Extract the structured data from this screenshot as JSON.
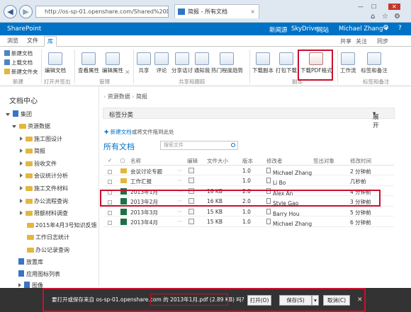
{
  "browser": {
    "address": "http://os-sp-01.openshare.com/Shared%20D",
    "address_host": "os-sp-01.openshare.com",
    "tab_title": "简报 - 所有文档",
    "tab_close": "×",
    "window_min": "—",
    "window_max": "☐",
    "window_close": "✕",
    "home": "⌂",
    "favorites": "☆",
    "settings": "⚙"
  },
  "topbar": {
    "brand": "SharePoint",
    "links": [
      "新闻源",
      "SkyDrive",
      "网站"
    ],
    "user": "Michael Zhang ▾",
    "gear": "⚙",
    "help": "?"
  },
  "ribbon_tabs": [
    "浏览",
    "文件",
    "库"
  ],
  "ribbon_tools": {
    "share": "共享",
    "follow": "关注",
    "sync": "同步"
  },
  "ribbon": {
    "new_doc": "新建文档",
    "upload": "上载文档",
    "new_folder": "新建文件夹",
    "edit_doc": "编辑文档",
    "view_props": "查看属性",
    "edit_props": "编辑属性",
    "share": "共享",
    "comment": "评论",
    "share_to": "分享话讨",
    "alert": "通知我",
    "popular": "热门程度趋势",
    "download": "下载副本",
    "pack_download": "打包下载",
    "pdf": "下载PDF格式",
    "workflow": "工作流",
    "tags": "标签和备注",
    "groups": [
      "新建",
      "打开并签出",
      "管理",
      "共享和跟踪",
      "副本",
      "标签和备注"
    ]
  },
  "nav": {
    "title": "文档中心",
    "items": [
      "集团",
      "资源数据",
      "施工图设计",
      "简报",
      "验收文件",
      "会议统计分析",
      "施工文件材料",
      "办公流程查询",
      "限额材料调查",
      "2015年4月3号知识反馈",
      "工作日志统计",
      "办公记录查询",
      "放置库",
      "应用图标列表",
      "图像"
    ]
  },
  "breadcrumb": [
    "资源数据",
    "简报"
  ],
  "classify": {
    "label": "标签分类",
    "expand": "展开"
  },
  "newdoc": {
    "link": "新建文档",
    "rest": "或将文件拖到此处"
  },
  "view": {
    "title": "所有文档",
    "search_placeholder": "搜索文件"
  },
  "columns": [
    "名称",
    "编辑",
    "文件大小",
    "版本",
    "修改者",
    "签出对象",
    "修改时间"
  ],
  "rows": [
    {
      "type": "folder",
      "name": "会议讨论专题",
      "size": "",
      "version": "1.0",
      "modifier": "Michael Zhang",
      "checkout": "",
      "time": "2 分钟前"
    },
    {
      "type": "folder",
      "name": "工作汇报",
      "size": "",
      "version": "1.0",
      "modifier": "Li Bo",
      "checkout": "",
      "time": "几秒前"
    },
    {
      "type": "xls",
      "name": "2013年1月",
      "size": "18 KB",
      "version": "2.0",
      "modifier": "Alex An",
      "checkout": "",
      "time": "4 分钟前"
    },
    {
      "type": "xls",
      "name": "2013年2月",
      "size": "16 KB",
      "version": "2.0",
      "modifier": "Style Gao",
      "checkout": "",
      "time": "3 分钟前"
    },
    {
      "type": "xls",
      "name": "2013年3月",
      "size": "15 KB",
      "version": "1.0",
      "modifier": "Barry Hou",
      "checkout": "",
      "time": "5 分钟前"
    },
    {
      "type": "xls",
      "name": "2013年4月",
      "size": "15 KB",
      "version": "1.0",
      "modifier": "Michael Zhang",
      "checkout": "",
      "time": "6 分钟前"
    }
  ],
  "download_bar": {
    "prefix": "要打开或保存来自",
    "host": "os-sp-01.openshare.com",
    "mid": "的",
    "filename": "2013年1月.pdf",
    "size": "(2.89 KB)",
    "suffix": "吗?",
    "open": "打开(O)",
    "save": "保存(S)",
    "save_arrow": "▾",
    "cancel": "取消(C)",
    "close": "✕"
  },
  "colors": {
    "accent": "#0072c6",
    "highlight": "#c8102e",
    "dl_bg": "#333333"
  }
}
